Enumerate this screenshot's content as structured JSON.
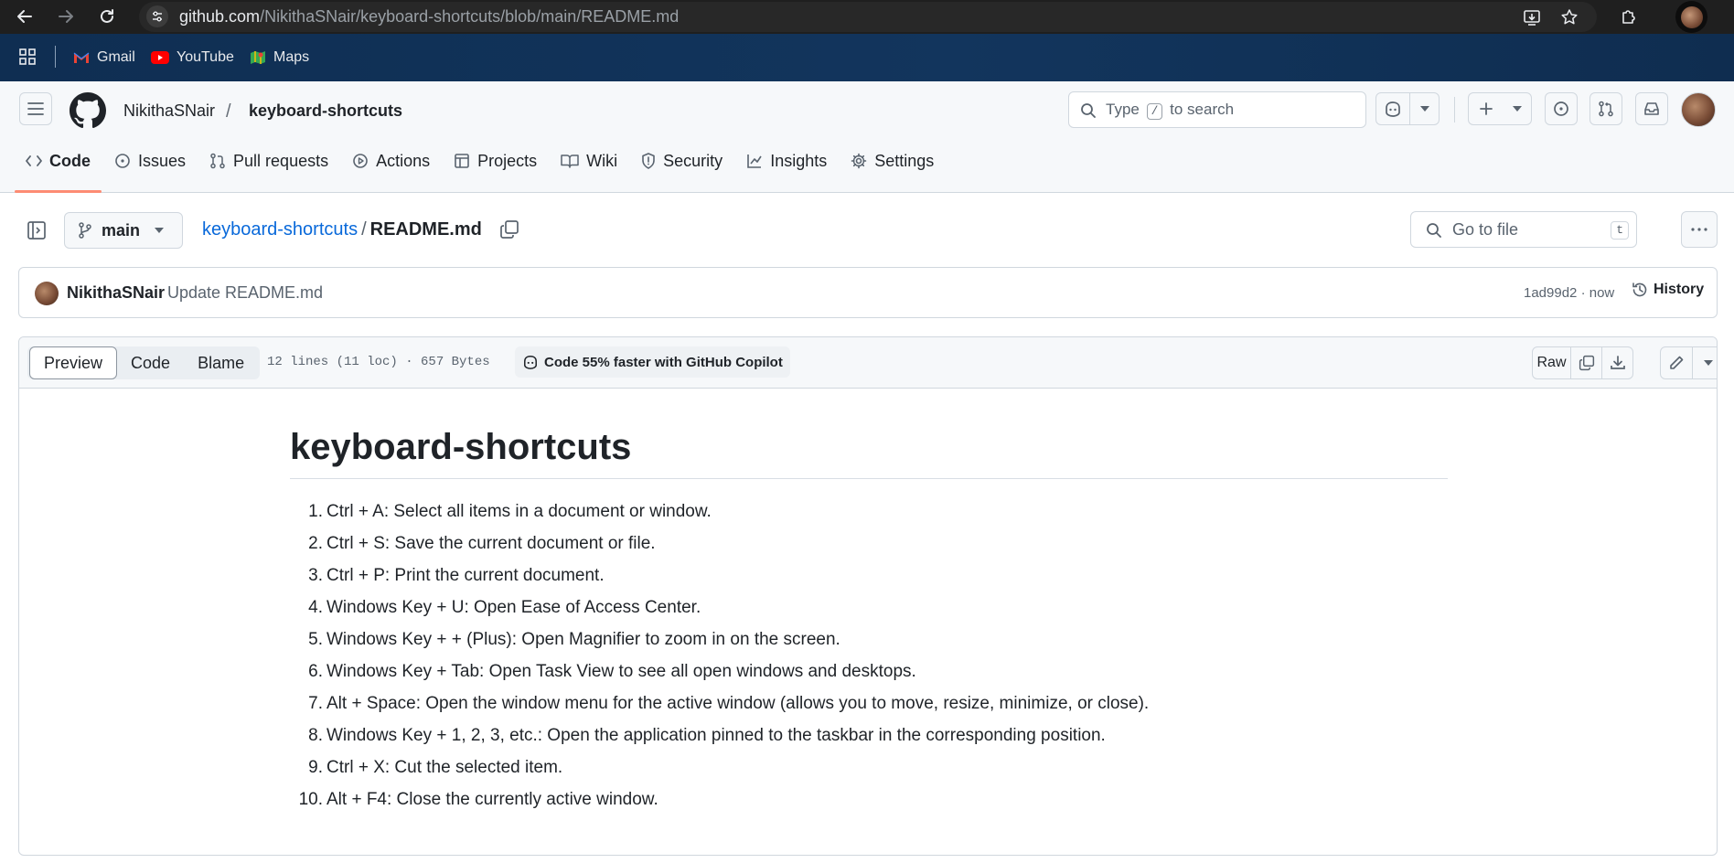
{
  "browser": {
    "url_host": "github.com",
    "url_path": "/NikithaSNair/keyboard-shortcuts/blob/main/README.md",
    "bookmarks": [
      {
        "label": "Gmail",
        "icon": "gmail-icon"
      },
      {
        "label": "YouTube",
        "icon": "youtube-icon"
      },
      {
        "label": "Maps",
        "icon": "maps-icon"
      }
    ]
  },
  "header": {
    "owner": "NikithaSNair",
    "separator": "/",
    "repo": "keyboard-shortcuts",
    "search": {
      "prefix": "Type",
      "key": "/",
      "suffix": "to search"
    }
  },
  "repo_nav": [
    {
      "label": "Code",
      "icon": "code-icon",
      "active": true
    },
    {
      "label": "Issues",
      "icon": "issue-icon"
    },
    {
      "label": "Pull requests",
      "icon": "pull-request-icon"
    },
    {
      "label": "Actions",
      "icon": "actions-icon"
    },
    {
      "label": "Projects",
      "icon": "projects-icon"
    },
    {
      "label": "Wiki",
      "icon": "wiki-icon"
    },
    {
      "label": "Security",
      "icon": "shield-icon"
    },
    {
      "label": "Insights",
      "icon": "graph-icon"
    },
    {
      "label": "Settings",
      "icon": "gear-icon"
    }
  ],
  "file_header": {
    "branch": "main",
    "repo_link": "keyboard-shortcuts",
    "separator": "/",
    "filename": "README.md",
    "goto_placeholder": "Go to file",
    "goto_key": "t"
  },
  "commit": {
    "author": "NikithaSNair",
    "message": "Update README.md",
    "meta": "1ad99d2 · now",
    "history_label": "History"
  },
  "toolbar": {
    "views": [
      "Preview",
      "Code",
      "Blame"
    ],
    "selected_view": "Preview",
    "file_info": "12 lines (11 loc) · 657 Bytes",
    "copilot": "Code 55% faster with GitHub Copilot",
    "raw_label": "Raw"
  },
  "readme": {
    "title": "keyboard-shortcuts",
    "items": [
      {
        "num": "1.",
        "text": "Ctrl + A: Select all items in a document or window."
      },
      {
        "num": "2.",
        "text": "Ctrl + S: Save the current document or file."
      },
      {
        "num": "3.",
        "text": "Ctrl + P: Print the current document."
      },
      {
        "num": "4.",
        "text": "Windows Key + U: Open Ease of Access Center."
      },
      {
        "num": "5.",
        "text": "Windows Key + + (Plus): Open Magnifier to zoom in on the screen."
      },
      {
        "num": "6.",
        "text": "Windows Key + Tab: Open Task View to see all open windows and desktops."
      },
      {
        "num": "7.",
        "text": "Alt + Space: Open the window menu for the active window (allows you to move, resize, minimize, or close)."
      },
      {
        "num": "8.",
        "text": "Windows Key + 1, 2, 3, etc.: Open the application pinned to the taskbar in the corresponding position."
      },
      {
        "num": "9.",
        "text": "Ctrl + X: Cut the selected item."
      },
      {
        "num": "10.",
        "text": "Alt + F4: Close the currently active window."
      }
    ]
  },
  "colors": {
    "link": "#0969da",
    "active_tab_underline": "#fd8c73",
    "chrome_bar": "#1f1f1f",
    "bookmarks_bar": "#12355d"
  }
}
